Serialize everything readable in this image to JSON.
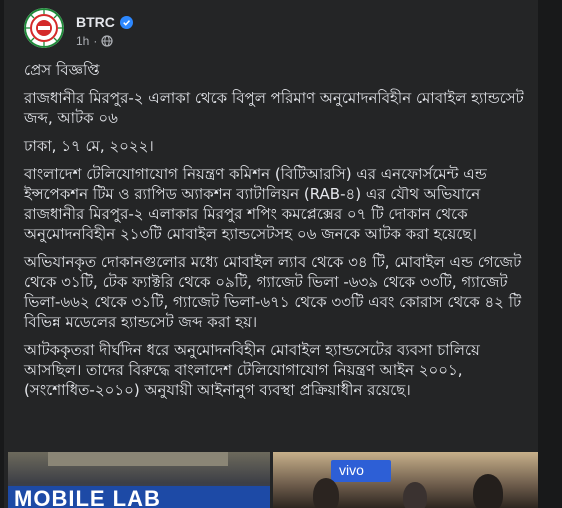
{
  "post": {
    "page_name": "BTRC",
    "timestamp": "1h",
    "separator": "·",
    "paragraphs": [
      "প্রেস বিজ্ঞপ্তি",
      "রাজধানীর মিরপুর-২ এলাকা থেকে বিপুল পরিমাণ অনুমোদনবিহীন মোবাইল হ্যান্ডসেট জব্দ, আটক ০৬",
      "ঢাকা, ১৭ মে, ২০২২।",
      "বাংলাদেশ টেলিযোগাযোগ নিয়ন্ত্রণ কমিশন (বিটিআরসি) এর এনফোর্সমেন্ট এন্ড ইন্সপেকশন টিম ও র‍্যাপিড অ্যাকশন ব্যাটালিয়ন (RAB-৪) এর যৌথ অভিযানে রাজধানীর মিরপুর-২ এলাকার মিরপুর শপিং কমপ্লেক্সের ০৭ টি দোকান থেকে অনুমোদনবিহীন ২১৩টি মোবাইল হ্যান্ডসেটসহ ০৬ জনকে আটক করা হয়েছে।",
      "অভিযানকৃত দোকানগুলোর মধ্যে মোবাইল ল্যাব থেকে ৩৪ টি, মোবাইল এন্ড গেজেট থেকে ৩১টি, টেক ফ্যাক্টরি থেকে ০৯টি,  গ্যাজেট ভিলা -৬৩৯ থেকে ৩৩টি, গ্যাজেট ভিলা-৬৬২  থেকে ৩১টি, গ্যাজেট ভিলা-৬৭১ থেকে ৩৩টি এবং কোরাস থেকে ৪২ টি বিভিন্ন মডেলের হ্যান্ডসেট জব্দ করা হয়।",
      "আটককৃতরা দীর্ঘদিন ধরে অনুমোদনবিহীন মোবাইল হ্যান্ডসেটের ব্যবসা চালিয়ে আসছিল। তাদের বিরুদ্ধে বাংলাদেশ টেলিযোগাযোগ নিয়ন্ত্রণ আইন ২০০১, (সংশোধিত-২০১০) অনুযায়ী আইনানুগ ব্যবস্থা প্রক্রিয়াধীন রয়েছে।"
    ],
    "photos": {
      "left_sign": "MOBILE LAB",
      "right_sign": "vivo"
    }
  },
  "icons": {
    "verified": "verified-badge-icon",
    "audience": "globe-icon"
  },
  "colors": {
    "background": "#18191a",
    "card": "#242526",
    "text": "#e4e6eb",
    "muted": "#b0b3b8",
    "verified": "#2d88ff",
    "logo_red": "#d42a2a",
    "logo_green": "#1f8a3a"
  }
}
